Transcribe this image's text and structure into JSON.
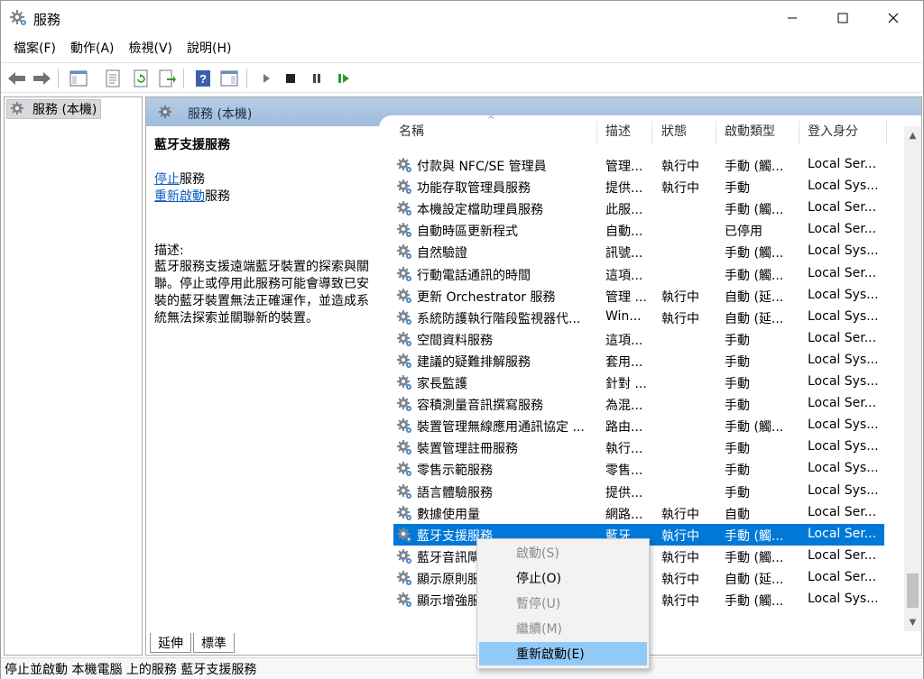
{
  "window": {
    "title": "服務",
    "minimize_label": "Minimize",
    "maximize_label": "Maximize",
    "close_label": "Close"
  },
  "menu": [
    "檔案(F)",
    "動作(A)",
    "檢視(V)",
    "說明(H)"
  ],
  "toolbar": {
    "icons": [
      "back-arrow-icon",
      "forward-arrow-icon",
      "show-hide-console-tree-icon",
      "properties-icon",
      "refresh-icon",
      "export-list-icon",
      "help-icon",
      "show-hide-action-pane-icon",
      "start-service-icon",
      "stop-service-icon",
      "pause-service-icon",
      "restart-service-icon"
    ]
  },
  "tree": {
    "root_label": "服務 (本機)"
  },
  "main": {
    "header_label": "服務 (本機)",
    "selected_service": "藍牙支援服務",
    "action_stop_link": "停止",
    "action_stop_suffix": "服務",
    "action_restart_link": "重新啟動",
    "action_restart_suffix": "服務",
    "description_heading": "描述:",
    "description_text": "藍牙服務支援遠端藍牙裝置的探索與關聯。停止或停用此服務可能會導致已安裝的藍牙裝置無法正確運作，並造成系統無法探索並關聯新的裝置。"
  },
  "columns": {
    "name": "名稱",
    "description": "描述",
    "status": "狀態",
    "startup_type": "啟動類型",
    "log_on_as": "登入身分",
    "sort_indicator": "^"
  },
  "services": [
    {
      "name": "付款與 NFC/SE 管理員",
      "desc": "管理...",
      "status": "執行中",
      "startup": "手動 (觸...",
      "logon": "Local Ser..."
    },
    {
      "name": "功能存取管理員服務",
      "desc": "提供...",
      "status": "執行中",
      "startup": "手動",
      "logon": "Local Sys..."
    },
    {
      "name": "本機設定檔助理員服務",
      "desc": "此服...",
      "status": "",
      "startup": "手動 (觸...",
      "logon": "Local Ser..."
    },
    {
      "name": "自動時區更新程式",
      "desc": "自動...",
      "status": "",
      "startup": "已停用",
      "logon": "Local Ser..."
    },
    {
      "name": "自然驗證",
      "desc": "訊號...",
      "status": "",
      "startup": "手動 (觸...",
      "logon": "Local Sys..."
    },
    {
      "name": "行動電話通訊的時間",
      "desc": "這項...",
      "status": "",
      "startup": "手動 (觸...",
      "logon": "Local Ser..."
    },
    {
      "name": "更新 Orchestrator 服務",
      "desc": "管理 ...",
      "status": "執行中",
      "startup": "自動 (延...",
      "logon": "Local Sys..."
    },
    {
      "name": "系統防護執行階段監視器代...",
      "desc": "Win...",
      "status": "執行中",
      "startup": "自動 (延...",
      "logon": "Local Sys..."
    },
    {
      "name": "空間資料服務",
      "desc": "這項...",
      "status": "",
      "startup": "手動",
      "logon": "Local Ser..."
    },
    {
      "name": "建議的疑難排解服務",
      "desc": "套用...",
      "status": "",
      "startup": "手動",
      "logon": "Local Sys..."
    },
    {
      "name": "家長監護",
      "desc": "針對 ...",
      "status": "",
      "startup": "手動",
      "logon": "Local Sys..."
    },
    {
      "name": "容積測量音訊撰寫服務",
      "desc": "為混...",
      "status": "",
      "startup": "手動",
      "logon": "Local Ser..."
    },
    {
      "name": "裝置管理無線應用通訊協定 ...",
      "desc": "路由...",
      "status": "",
      "startup": "手動 (觸...",
      "logon": "Local Sys..."
    },
    {
      "name": "裝置管理註冊服務",
      "desc": "執行...",
      "status": "",
      "startup": "手動",
      "logon": "Local Sys..."
    },
    {
      "name": "零售示範服務",
      "desc": "零售...",
      "status": "",
      "startup": "手動",
      "logon": "Local Sys..."
    },
    {
      "name": "語言體驗服務",
      "desc": "提供...",
      "status": "",
      "startup": "手動",
      "logon": "Local Sys..."
    },
    {
      "name": "數據使用量",
      "desc": "網路...",
      "status": "執行中",
      "startup": "自動",
      "logon": "Local Ser..."
    },
    {
      "name": "藍牙支援服務",
      "desc": "藍牙...",
      "status": "執行中",
      "startup": "手動 (觸...",
      "logon": "Local Ser..."
    },
    {
      "name": "藍牙音訊閘道服務",
      "desc": "",
      "status": "執行中",
      "startup": "手動 (觸...",
      "logon": "Local Ser..."
    },
    {
      "name": "顯示原則服務",
      "desc": "",
      "status": "執行中",
      "startup": "自動 (延...",
      "logon": "Local Ser..."
    },
    {
      "name": "顯示增強服務",
      "desc": "",
      "status": "執行中",
      "startup": "手動 (觸...",
      "logon": "Local Sys..."
    }
  ],
  "selected_index": 17,
  "tabs": [
    "延伸",
    "標準"
  ],
  "status_bar": "停止並啟動 本機電腦 上的服務 藍牙支援服務",
  "context_menu": [
    {
      "label": "啟動(S)",
      "enabled": false
    },
    {
      "label": "停止(O)",
      "enabled": true
    },
    {
      "label": "暫停(U)",
      "enabled": false
    },
    {
      "label": "繼續(M)",
      "enabled": false
    },
    {
      "label": "重新啟動(E)",
      "enabled": true,
      "highlighted": true
    }
  ],
  "colors": {
    "selection": "#0078d7",
    "menu_highlight": "#91c9f7",
    "header_blue": "#a9c4e0",
    "link": "#0b5ebf"
  }
}
